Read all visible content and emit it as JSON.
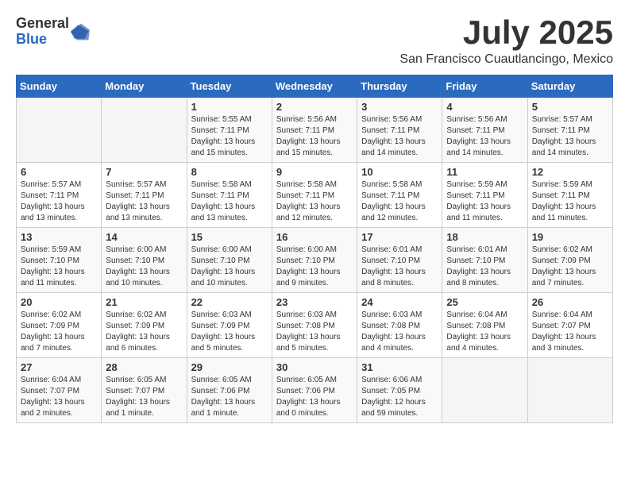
{
  "logo": {
    "general": "General",
    "blue": "Blue"
  },
  "title": "July 2025",
  "location": "San Francisco Cuautlancingo, Mexico",
  "days_of_week": [
    "Sunday",
    "Monday",
    "Tuesday",
    "Wednesday",
    "Thursday",
    "Friday",
    "Saturday"
  ],
  "weeks": [
    [
      {
        "day": "",
        "sunrise": "",
        "sunset": "",
        "daylight": ""
      },
      {
        "day": "",
        "sunrise": "",
        "sunset": "",
        "daylight": ""
      },
      {
        "day": "1",
        "sunrise": "Sunrise: 5:55 AM",
        "sunset": "Sunset: 7:11 PM",
        "daylight": "Daylight: 13 hours and 15 minutes."
      },
      {
        "day": "2",
        "sunrise": "Sunrise: 5:56 AM",
        "sunset": "Sunset: 7:11 PM",
        "daylight": "Daylight: 13 hours and 15 minutes."
      },
      {
        "day": "3",
        "sunrise": "Sunrise: 5:56 AM",
        "sunset": "Sunset: 7:11 PM",
        "daylight": "Daylight: 13 hours and 14 minutes."
      },
      {
        "day": "4",
        "sunrise": "Sunrise: 5:56 AM",
        "sunset": "Sunset: 7:11 PM",
        "daylight": "Daylight: 13 hours and 14 minutes."
      },
      {
        "day": "5",
        "sunrise": "Sunrise: 5:57 AM",
        "sunset": "Sunset: 7:11 PM",
        "daylight": "Daylight: 13 hours and 14 minutes."
      }
    ],
    [
      {
        "day": "6",
        "sunrise": "Sunrise: 5:57 AM",
        "sunset": "Sunset: 7:11 PM",
        "daylight": "Daylight: 13 hours and 13 minutes."
      },
      {
        "day": "7",
        "sunrise": "Sunrise: 5:57 AM",
        "sunset": "Sunset: 7:11 PM",
        "daylight": "Daylight: 13 hours and 13 minutes."
      },
      {
        "day": "8",
        "sunrise": "Sunrise: 5:58 AM",
        "sunset": "Sunset: 7:11 PM",
        "daylight": "Daylight: 13 hours and 13 minutes."
      },
      {
        "day": "9",
        "sunrise": "Sunrise: 5:58 AM",
        "sunset": "Sunset: 7:11 PM",
        "daylight": "Daylight: 13 hours and 12 minutes."
      },
      {
        "day": "10",
        "sunrise": "Sunrise: 5:58 AM",
        "sunset": "Sunset: 7:11 PM",
        "daylight": "Daylight: 13 hours and 12 minutes."
      },
      {
        "day": "11",
        "sunrise": "Sunrise: 5:59 AM",
        "sunset": "Sunset: 7:11 PM",
        "daylight": "Daylight: 13 hours and 11 minutes."
      },
      {
        "day": "12",
        "sunrise": "Sunrise: 5:59 AM",
        "sunset": "Sunset: 7:11 PM",
        "daylight": "Daylight: 13 hours and 11 minutes."
      }
    ],
    [
      {
        "day": "13",
        "sunrise": "Sunrise: 5:59 AM",
        "sunset": "Sunset: 7:10 PM",
        "daylight": "Daylight: 13 hours and 11 minutes."
      },
      {
        "day": "14",
        "sunrise": "Sunrise: 6:00 AM",
        "sunset": "Sunset: 7:10 PM",
        "daylight": "Daylight: 13 hours and 10 minutes."
      },
      {
        "day": "15",
        "sunrise": "Sunrise: 6:00 AM",
        "sunset": "Sunset: 7:10 PM",
        "daylight": "Daylight: 13 hours and 10 minutes."
      },
      {
        "day": "16",
        "sunrise": "Sunrise: 6:00 AM",
        "sunset": "Sunset: 7:10 PM",
        "daylight": "Daylight: 13 hours and 9 minutes."
      },
      {
        "day": "17",
        "sunrise": "Sunrise: 6:01 AM",
        "sunset": "Sunset: 7:10 PM",
        "daylight": "Daylight: 13 hours and 8 minutes."
      },
      {
        "day": "18",
        "sunrise": "Sunrise: 6:01 AM",
        "sunset": "Sunset: 7:10 PM",
        "daylight": "Daylight: 13 hours and 8 minutes."
      },
      {
        "day": "19",
        "sunrise": "Sunrise: 6:02 AM",
        "sunset": "Sunset: 7:09 PM",
        "daylight": "Daylight: 13 hours and 7 minutes."
      }
    ],
    [
      {
        "day": "20",
        "sunrise": "Sunrise: 6:02 AM",
        "sunset": "Sunset: 7:09 PM",
        "daylight": "Daylight: 13 hours and 7 minutes."
      },
      {
        "day": "21",
        "sunrise": "Sunrise: 6:02 AM",
        "sunset": "Sunset: 7:09 PM",
        "daylight": "Daylight: 13 hours and 6 minutes."
      },
      {
        "day": "22",
        "sunrise": "Sunrise: 6:03 AM",
        "sunset": "Sunset: 7:09 PM",
        "daylight": "Daylight: 13 hours and 5 minutes."
      },
      {
        "day": "23",
        "sunrise": "Sunrise: 6:03 AM",
        "sunset": "Sunset: 7:08 PM",
        "daylight": "Daylight: 13 hours and 5 minutes."
      },
      {
        "day": "24",
        "sunrise": "Sunrise: 6:03 AM",
        "sunset": "Sunset: 7:08 PM",
        "daylight": "Daylight: 13 hours and 4 minutes."
      },
      {
        "day": "25",
        "sunrise": "Sunrise: 6:04 AM",
        "sunset": "Sunset: 7:08 PM",
        "daylight": "Daylight: 13 hours and 4 minutes."
      },
      {
        "day": "26",
        "sunrise": "Sunrise: 6:04 AM",
        "sunset": "Sunset: 7:07 PM",
        "daylight": "Daylight: 13 hours and 3 minutes."
      }
    ],
    [
      {
        "day": "27",
        "sunrise": "Sunrise: 6:04 AM",
        "sunset": "Sunset: 7:07 PM",
        "daylight": "Daylight: 13 hours and 2 minutes."
      },
      {
        "day": "28",
        "sunrise": "Sunrise: 6:05 AM",
        "sunset": "Sunset: 7:07 PM",
        "daylight": "Daylight: 13 hours and 1 minute."
      },
      {
        "day": "29",
        "sunrise": "Sunrise: 6:05 AM",
        "sunset": "Sunset: 7:06 PM",
        "daylight": "Daylight: 13 hours and 1 minute."
      },
      {
        "day": "30",
        "sunrise": "Sunrise: 6:05 AM",
        "sunset": "Sunset: 7:06 PM",
        "daylight": "Daylight: 13 hours and 0 minutes."
      },
      {
        "day": "31",
        "sunrise": "Sunrise: 6:06 AM",
        "sunset": "Sunset: 7:05 PM",
        "daylight": "Daylight: 12 hours and 59 minutes."
      },
      {
        "day": "",
        "sunrise": "",
        "sunset": "",
        "daylight": ""
      },
      {
        "day": "",
        "sunrise": "",
        "sunset": "",
        "daylight": ""
      }
    ]
  ]
}
